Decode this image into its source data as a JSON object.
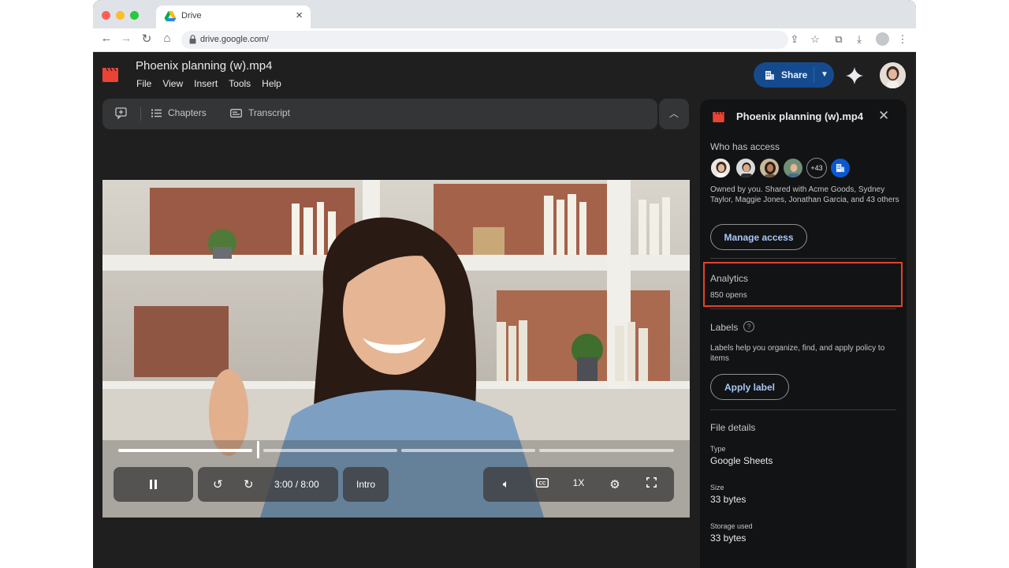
{
  "browser": {
    "tab_title": "Drive",
    "url": "drive.google.com/"
  },
  "header": {
    "doc_title": "Phoenix planning (w).mp4",
    "menu": [
      "File",
      "View",
      "Insert",
      "Tools",
      "Help"
    ],
    "share_label": "Share"
  },
  "toolbar": {
    "chapters_label": "Chapters",
    "transcript_label": "Transcript"
  },
  "player": {
    "time": "3:00 / 8:00",
    "chapter": "Intro",
    "speed": "1X",
    "progress": 0.25
  },
  "panel": {
    "title": "Phoenix planning (w).mp4",
    "access_heading": "Who has access",
    "more_count": "+43",
    "access_desc": "Owned by you. Shared with Acme Goods, Sydney Taylor, Maggie Jones, Jonathan Garcia, and 43 others",
    "manage_access": "Manage access",
    "analytics_heading": "Analytics",
    "analytics_value": "850 opens",
    "labels_heading": "Labels",
    "labels_desc": "Labels help you organize, find, and apply policy to items",
    "apply_label": "Apply label",
    "file_details_heading": "File details",
    "type_label": "Type",
    "type_value": "Google Sheets",
    "size_label": "Size",
    "size_value": "33 bytes",
    "storage_label": "Storage used",
    "storage_value": "33 bytes"
  },
  "colors": {
    "accent": "#154b8e",
    "highlight": "#e84225",
    "app_red": "#ea4335"
  }
}
